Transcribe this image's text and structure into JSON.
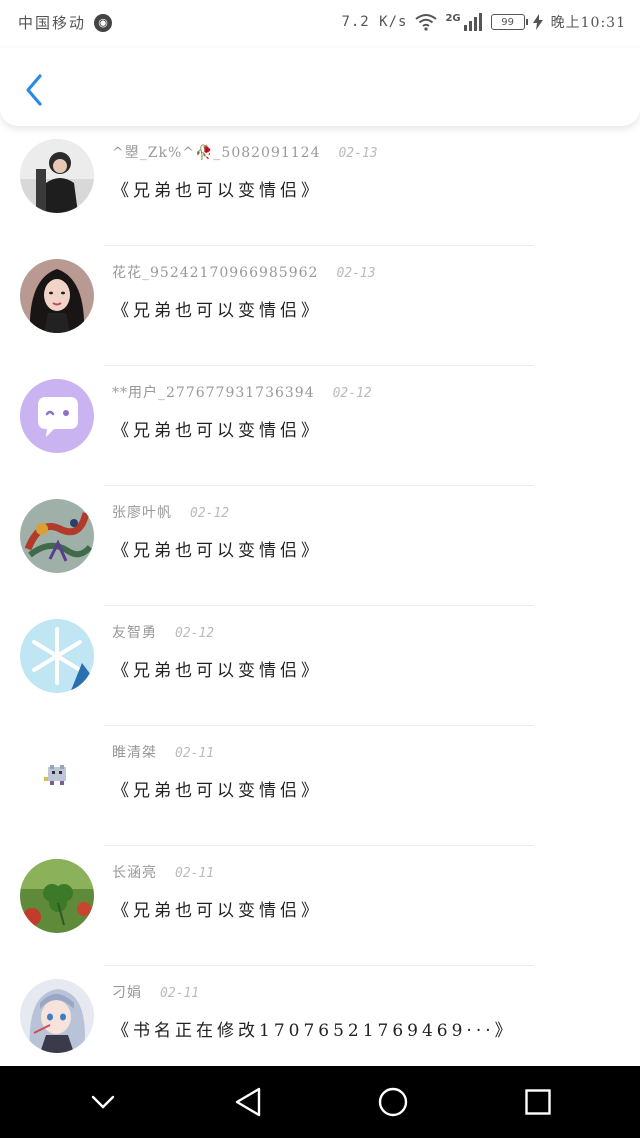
{
  "status_bar": {
    "carrier": "中国移动",
    "speed": "7.2 K/s",
    "network_type": "2G",
    "battery": "99",
    "time": "晚上10:31"
  },
  "messages": [
    {
      "user": "^曌_Zk%^🥀_5082091124",
      "date": "02-13",
      "text": "《兄弟也可以变情侣》",
      "avatar_style": "photo-boy"
    },
    {
      "user": "花花_95242170966985962",
      "date": "02-13",
      "text": "《兄弟也可以变情侣》",
      "avatar_style": "photo-girl"
    },
    {
      "user": "**用户_277677931736394",
      "date": "02-12",
      "text": "《兄弟也可以变情侣》",
      "avatar_style": "chat-bubble"
    },
    {
      "user": "张廖叶帆",
      "date": "02-12",
      "text": "《兄弟也可以变情侣》",
      "avatar_style": "dragon"
    },
    {
      "user": "友智勇",
      "date": "02-12",
      "text": "《兄弟也可以变情侣》",
      "avatar_style": "snowflake"
    },
    {
      "user": "睢清桀",
      "date": "02-11",
      "text": "《兄弟也可以变情侣》",
      "avatar_style": "pixel-sprite"
    },
    {
      "user": "长涵亮",
      "date": "02-11",
      "text": "《兄弟也可以变情侣》",
      "avatar_style": "clover"
    },
    {
      "user": "刁娟",
      "date": "02-11",
      "text": "《书名正在修改17076521769469···》",
      "avatar_style": "anime"
    }
  ],
  "colors": {
    "accent": "#2b8ae8",
    "chat_avatar": "#c9b3f0",
    "snowflake_avatar": "#bfe6f2"
  }
}
